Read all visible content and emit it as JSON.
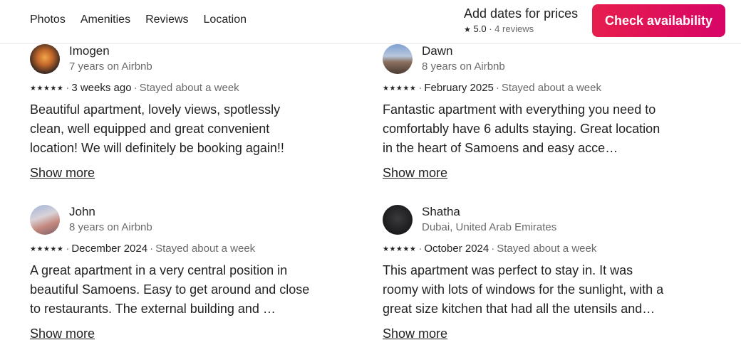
{
  "nav": {
    "tabs": [
      "Photos",
      "Amenities",
      "Reviews",
      "Location"
    ]
  },
  "price": {
    "title": "Add dates for prices",
    "rating": "5.0",
    "reviews": "4 reviews"
  },
  "cta": {
    "label": "Check availability"
  },
  "reviews": [
    {
      "name": "Imogen",
      "sub": "7 years on Airbnb",
      "stars": "★★★★★",
      "date": "3 weeks ago",
      "stay": "Stayed about a week",
      "text": "Beautiful apartment, lovely views, spotlessly clean, well equipped and great convenient location! We will definitely be booking again!!",
      "show_more": "Show more"
    },
    {
      "name": "Dawn",
      "sub": "8 years on Airbnb",
      "stars": "★★★★★",
      "date": "February 2025",
      "stay": "Stayed about a week",
      "text": "Fantastic apartment with everything you need to comfortably have 6 adults staying.  Great location in the heart of Samoens and easy acce…",
      "show_more": "Show more"
    },
    {
      "name": "John",
      "sub": "8 years on Airbnb",
      "stars": "★★★★★",
      "date": "December 2024",
      "stay": "Stayed about a week",
      "text": "A great apartment in a very central position in beautiful Samoens.  Easy to get around and close to restaurants.  The external building and …",
      "show_more": "Show more"
    },
    {
      "name": "Shatha",
      "sub": "Dubai, United Arab Emirates",
      "stars": "★★★★★",
      "date": "October 2024",
      "stay": "Stayed about a week",
      "text": "This apartment was perfect to stay in. It was roomy with lots of windows for the sunlight, with a great size kitchen that had all the utensils and…",
      "show_more": "Show more"
    }
  ]
}
